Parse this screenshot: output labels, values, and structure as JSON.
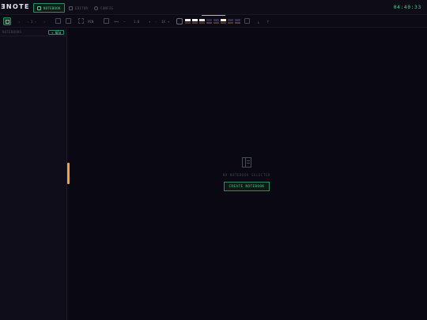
{
  "app": {
    "logo": "ƎNOTE"
  },
  "nav": {
    "tabs": [
      {
        "label": "NOTEBOOK",
        "active": true
      },
      {
        "label": "EDITOR",
        "active": false
      },
      {
        "label": "CONFIG",
        "active": false
      }
    ]
  },
  "clock": "04:40:33",
  "toolbar": {
    "undo": "‹",
    "page_nav": "‹ 1 ›",
    "redo": "›",
    "pen_label": "PEN",
    "size_label": "1.0",
    "opacity_label": "100",
    "zoom_label": "1X",
    "swatch_colors": [
      "#f3f3f3",
      "#ffffff",
      "#e6e6e6",
      "#2a2a40",
      "#2f2f48",
      "#fff3d0",
      "#2f2f48",
      "#2f2f48"
    ]
  },
  "sidebar": {
    "title": "NOTEBOOKS",
    "new_button": "+ NEW"
  },
  "main": {
    "empty_text": "NO NOTEBOOK SELECTED",
    "create_button": "CREATE NOTEBOOK"
  },
  "colors": {
    "accent": "#4fd69a",
    "warning": "#f0a63a",
    "background": "#0a0812"
  }
}
